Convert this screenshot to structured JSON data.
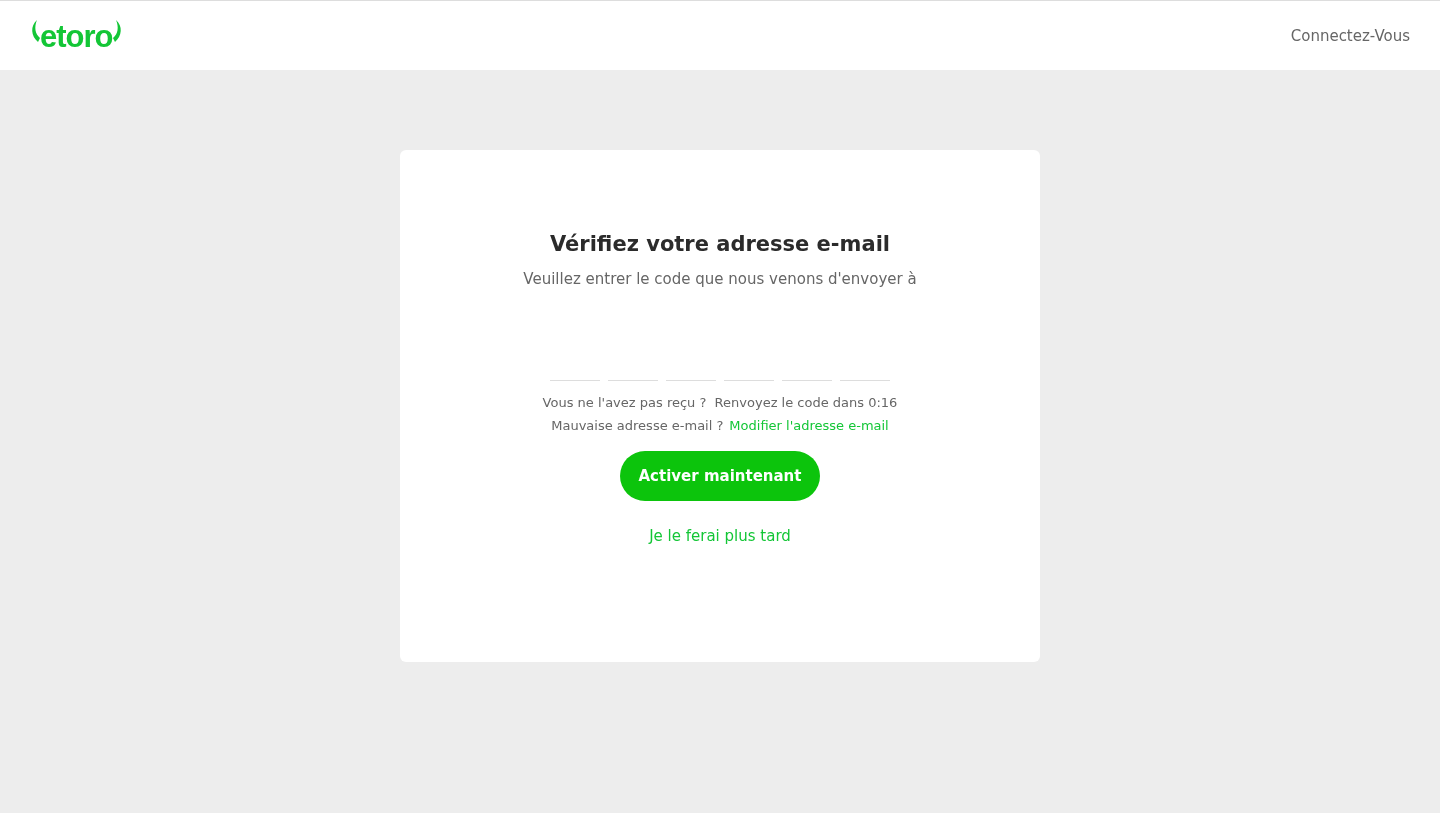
{
  "header": {
    "logo": "etoro",
    "login_link": "Connectez-Vous"
  },
  "card": {
    "title": "Vérifiez votre adresse e-mail",
    "subtitle": "Veuillez entrer le code que nous venons d'envoyer à",
    "code_fields": [
      {
        "kind": "digit"
      },
      {
        "kind": "digit"
      },
      {
        "kind": "digit"
      },
      {
        "kind": "digit"
      },
      {
        "kind": "digit"
      },
      {
        "kind": "digit"
      }
    ],
    "resend_text": "Vous ne l'avez pas reçu ?  Renvoyez le code dans 0:16",
    "wrong_email_text": "Mauvaise adresse e-mail ?",
    "change_email_link": "Modifier l'adresse e-mail",
    "primary_button": "Activer maintenant",
    "later_link": "Je le ferai plus tard"
  }
}
